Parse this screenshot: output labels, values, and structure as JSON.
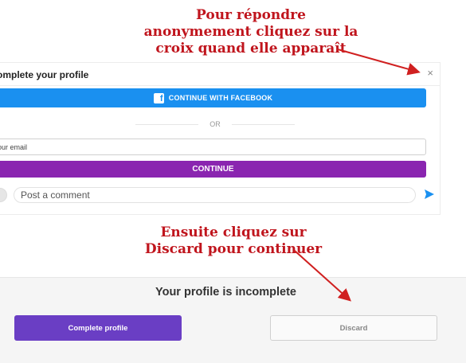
{
  "annotations": {
    "top": "Pour répondre anonymement cliquez sur la croix quand elle apparaît",
    "bottom": "Ensuite cliquez sur Discard pour continuer"
  },
  "panel": {
    "title": "omplete your profile",
    "close_icon": "×",
    "facebook_label_prefix": "CONTINUE WITH ",
    "facebook_label_brand": "FACEBOOK",
    "or_text": "OR",
    "email_value": "our email",
    "continue_label": "CONTINUE",
    "comment_placeholder": "Post a comment",
    "send_icon": "send-icon"
  },
  "bottom_bar": {
    "title": "Your profile is incomplete",
    "complete_label": "Complete profile",
    "discard_label": "Discard"
  },
  "colors": {
    "annotation": "#c0151d",
    "facebook": "#1a90f0",
    "continue": "#8a25b0",
    "complete": "#6a3ec4"
  }
}
